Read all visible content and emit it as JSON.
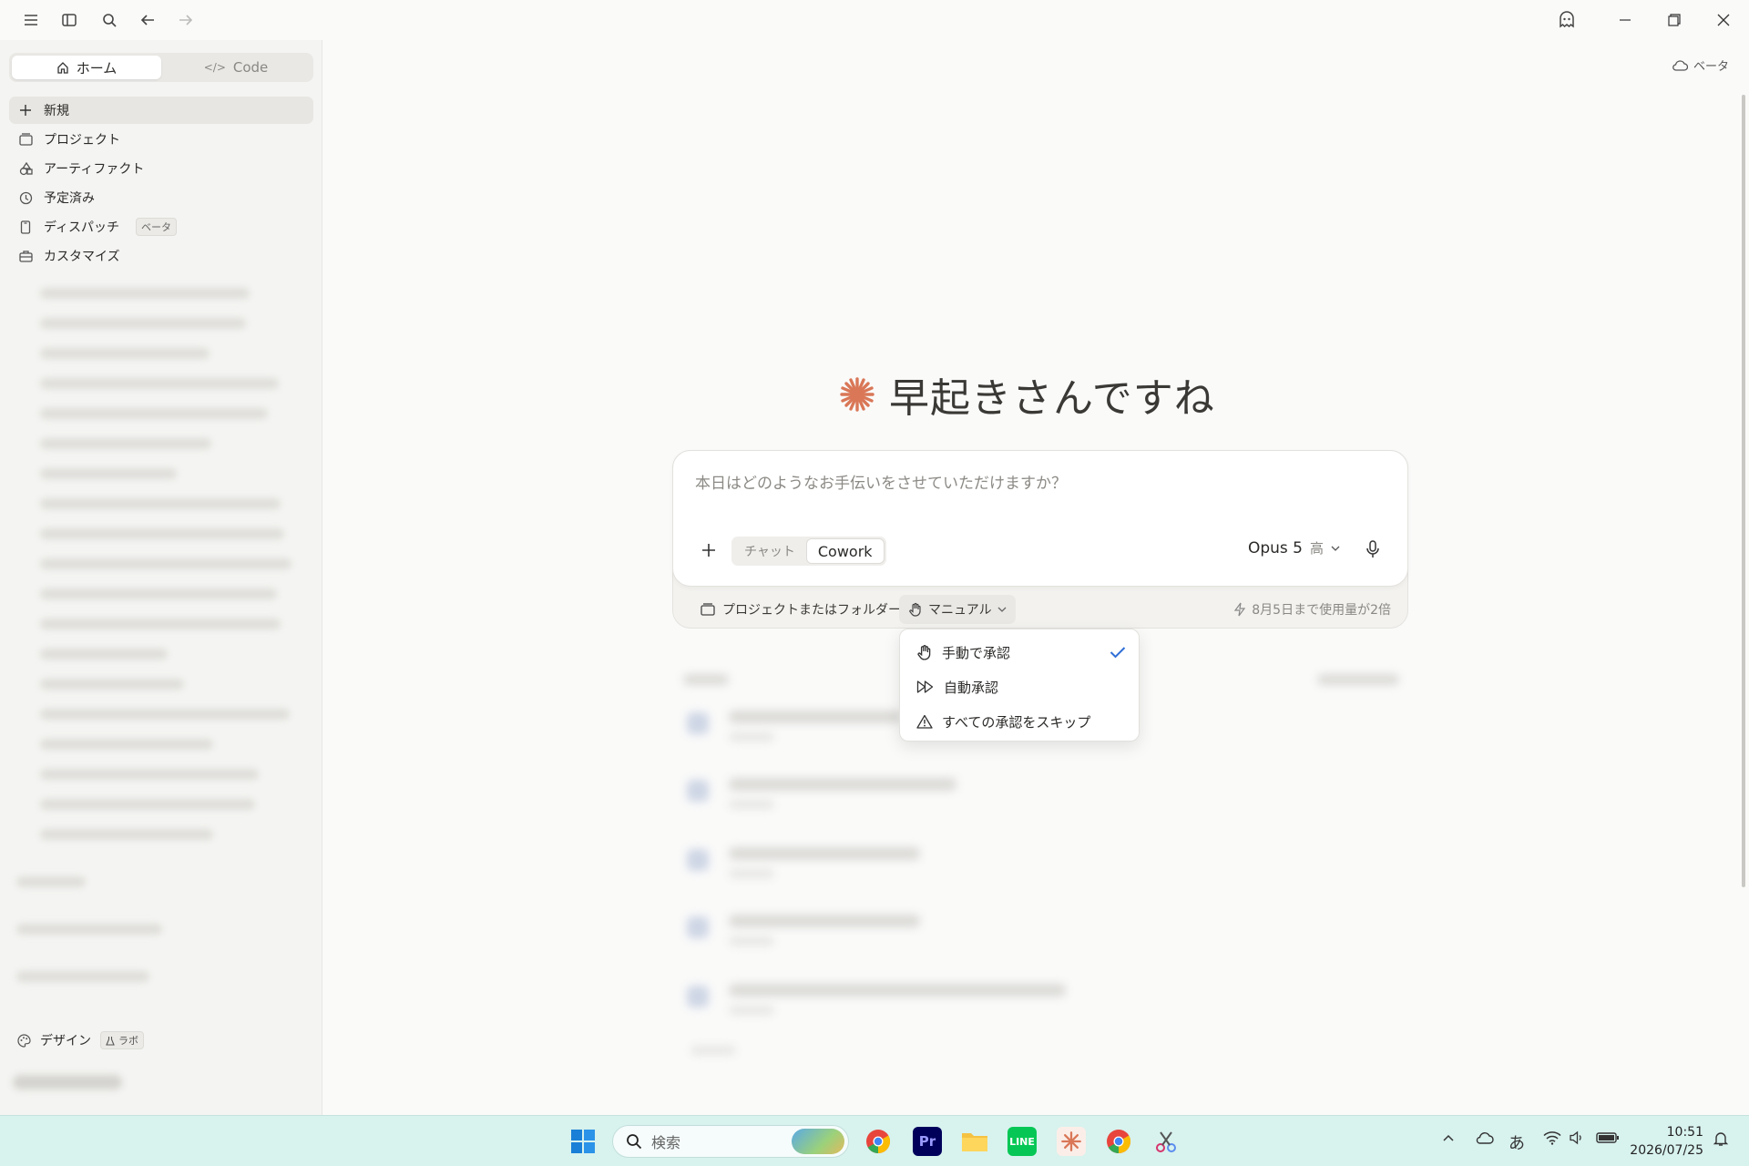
{
  "sidebar": {
    "tabs": [
      {
        "label": "ホーム",
        "icon": "home-icon"
      },
      {
        "label": "Code",
        "icon": "code-icon"
      }
    ],
    "nav": [
      {
        "label": "新規",
        "icon": "plus-icon"
      },
      {
        "label": "プロジェクト",
        "icon": "folder-icon"
      },
      {
        "label": "アーティファクト",
        "icon": "shapes-icon"
      },
      {
        "label": "予定済み",
        "icon": "clock-icon"
      },
      {
        "label": "ディスパッチ",
        "icon": "phone-icon",
        "badge": "ベータ"
      },
      {
        "label": "カスタマイズ",
        "icon": "briefcase-icon"
      }
    ],
    "design": {
      "label": "デザイン",
      "badge": "ラボ"
    }
  },
  "header": {
    "beta_label": "ベータ"
  },
  "hero": {
    "title": "早起きさんですね"
  },
  "composer": {
    "placeholder": "本日はどのようなお手伝いをさせていただけますか？",
    "modes": [
      "チャット",
      "Cowork"
    ],
    "model": "Opus 5",
    "effort": "高",
    "project_select": "プロジェクトまたはフォルダー",
    "approval_select": "マニュアル",
    "usage_note": "8月5日まで使用量が2倍"
  },
  "approval_menu": {
    "items": [
      {
        "label": "手動で承認",
        "icon": "hand-icon",
        "checked": true
      },
      {
        "label": "自動承認",
        "icon": "fast-forward-icon",
        "checked": false
      },
      {
        "label": "すべての承認をスキップ",
        "icon": "warning-icon",
        "checked": false
      }
    ]
  },
  "taskbar": {
    "search_placeholder": "検索",
    "time": "10:51",
    "date": "2026/07/25",
    "ime": "あ"
  },
  "colors": {
    "accent": "#d97757",
    "check": "#2f6fd6",
    "taskbar": "#d8f2ee"
  }
}
